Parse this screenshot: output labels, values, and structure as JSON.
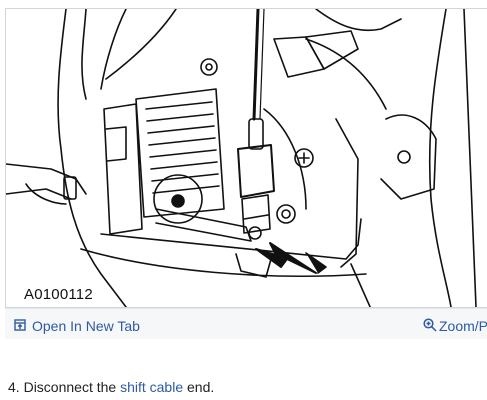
{
  "figure": {
    "code": "A0100112"
  },
  "toolbar": {
    "open_label": "Open In New Tab",
    "zoom_label": "Zoom/P"
  },
  "step": {
    "number": "4.",
    "before": "Disconnect the",
    "link": "shift cable",
    "after": "end."
  },
  "colors": {
    "link": "#2d5aa3",
    "line_art": "#111111",
    "toolbar_bg": "#f6f7f9"
  },
  "icons": {
    "open": "open-in-new-tab-icon",
    "zoom": "zoom-magnifier-icon"
  }
}
